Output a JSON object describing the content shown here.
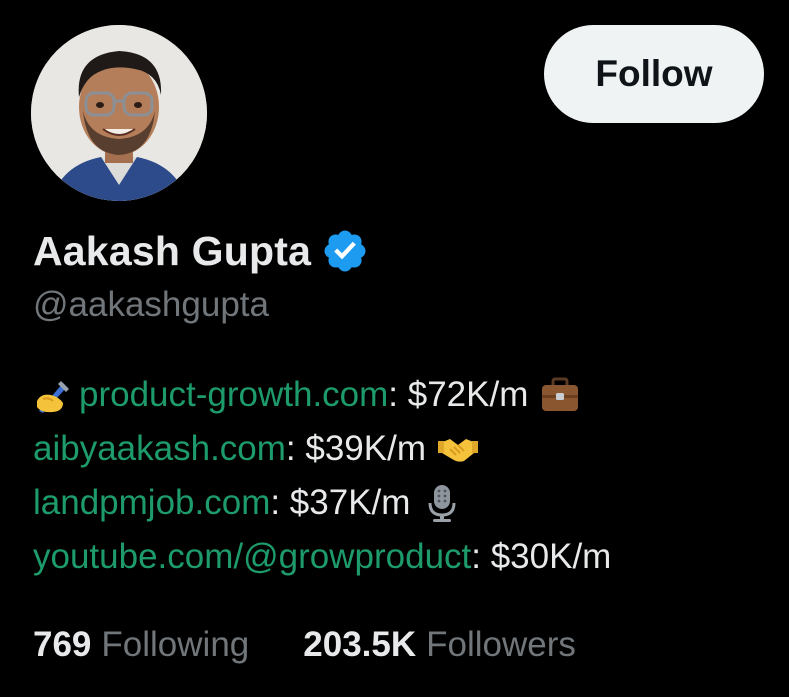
{
  "profile": {
    "display_name": "Aakash Gupta",
    "handle": "@aakashgupta",
    "verified_icon": "verified-badge-icon",
    "follow_label": "Follow"
  },
  "bio": {
    "lines": [
      {
        "lead_icon": "writing-hand-emoji",
        "link": "product-growth.com",
        "text": ": $72K/m",
        "trail_icon": "briefcase-emoji"
      },
      {
        "link": "aibyaakash.com",
        "text": ": $39K/m",
        "trail_icon": "handshake-emoji"
      },
      {
        "link": "landpmjob.com",
        "text": ": $37K/m",
        "trail_icon": "microphone-emoji"
      },
      {
        "link": "youtube.com/@growproduct",
        "text": ": $30K/m"
      }
    ]
  },
  "stats": {
    "following_count": "769",
    "following_label": "Following",
    "followers_count": "203.5K",
    "followers_label": "Followers"
  },
  "colors": {
    "background": "#000000",
    "primary_text": "#e7e9ea",
    "secondary_text": "#71767b",
    "link": "#1d9b6b",
    "verified_badge": "#1d9bf0",
    "follow_button_bg": "#eff3f4"
  }
}
